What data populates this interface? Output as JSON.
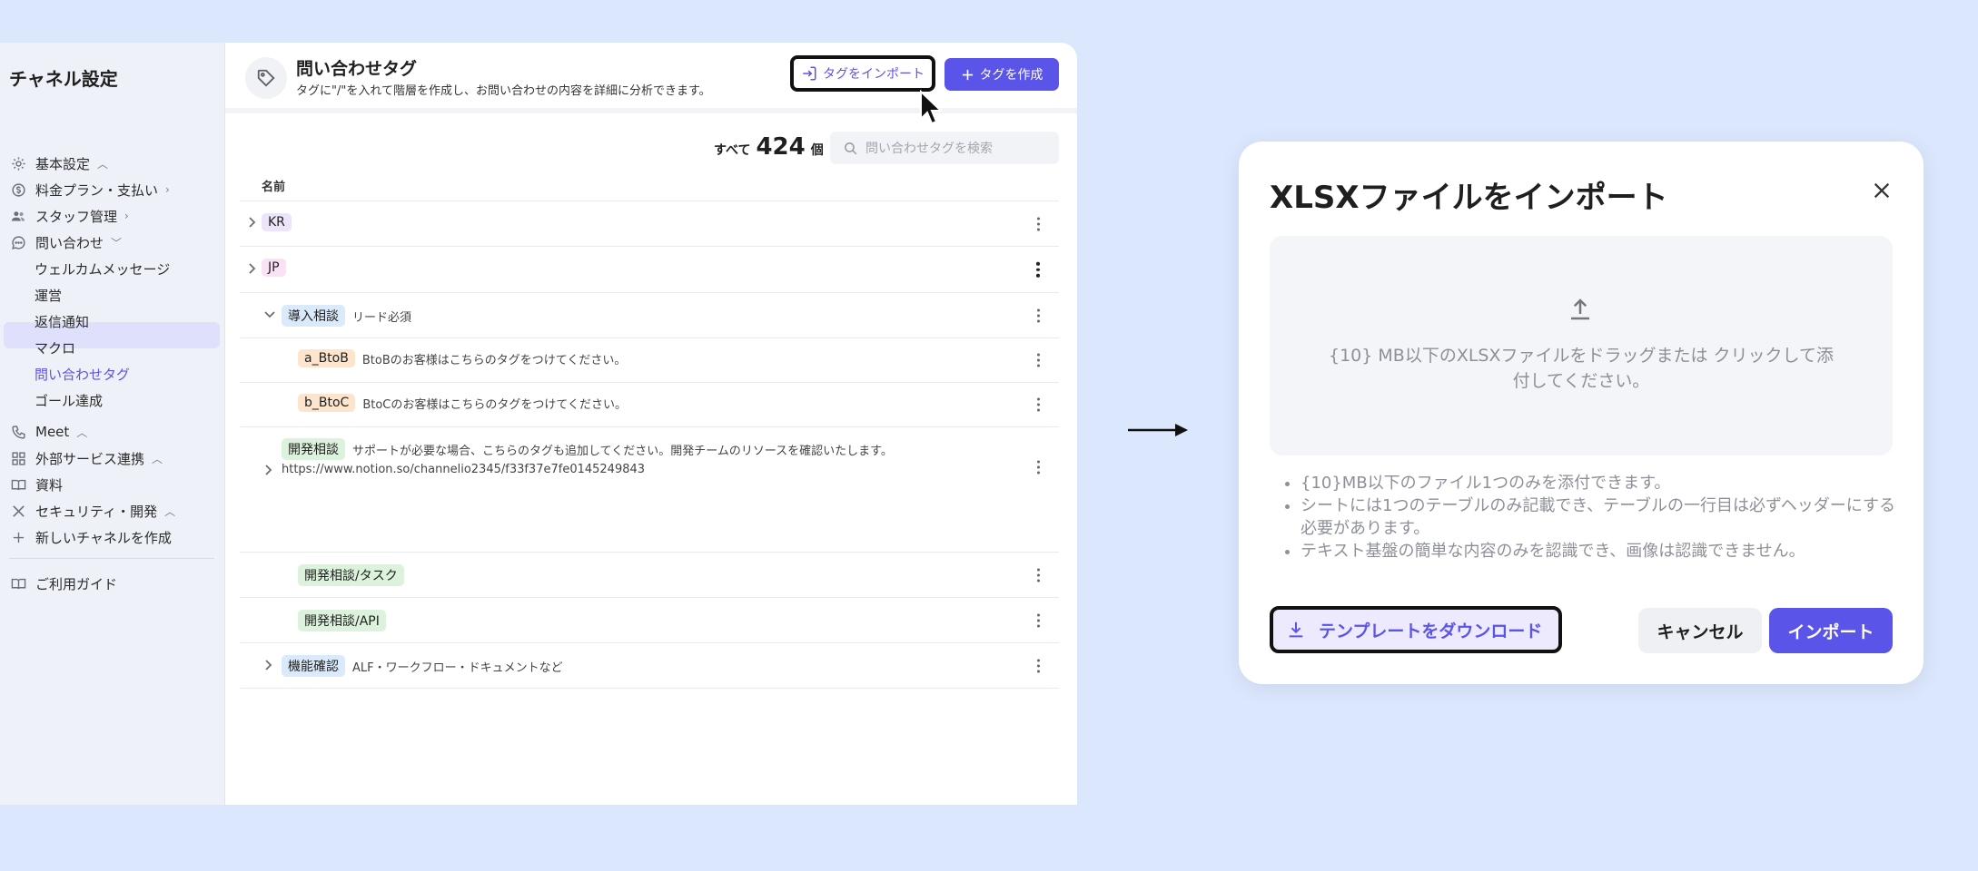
{
  "sidebar": {
    "title": "チャネル設定",
    "items": [
      {
        "label": "基本設定",
        "icon": "gear-icon"
      },
      {
        "label": "料金プラン・支払い",
        "icon": "dollar-icon"
      },
      {
        "label": "スタッフ管理",
        "icon": "people-icon"
      },
      {
        "label": "問い合わせ",
        "icon": "chat-icon"
      }
    ],
    "sub_items": [
      "ウェルカムメッセージ",
      "運営",
      "返信通知",
      "マクロ",
      "問い合わせタグ",
      "ゴール達成"
    ],
    "lower_items": [
      {
        "label": "Meet",
        "icon": "phone-icon"
      },
      {
        "label": "外部サービス連携",
        "icon": "grid-icon"
      },
      {
        "label": "資料",
        "icon": "book-icon"
      },
      {
        "label": "セキュリティ・開発",
        "icon": "tools-icon"
      },
      {
        "label": "新しいチャネルを作成",
        "icon": "plus-icon"
      }
    ],
    "guide": {
      "label": "ご利用ガイド",
      "icon": "book-icon"
    }
  },
  "header": {
    "title": "問い合わせタグ",
    "subtitle": "タグに\"/\"を入れて階層を作成し、お問い合わせの内容を詳細に分析できます。",
    "import_label": "タグをインポート",
    "create_label": "タグを作成"
  },
  "toolbar": {
    "count_label": "すべて",
    "count": "424",
    "count_unit": "個",
    "search_placeholder": "問い合わせタグを検索"
  },
  "table": {
    "column_name": "名前",
    "rows": [
      {
        "tag": "KR",
        "desc": ""
      },
      {
        "tag": "JP",
        "desc": ""
      },
      {
        "tag": "導入相談",
        "desc": "リード必須"
      },
      {
        "tag": "a_BtoB",
        "desc": "BtoBのお客様はこちらのタグをつけてください。"
      },
      {
        "tag": "b_BtoC",
        "desc": "BtoCのお客様はこちらのタグをつけてください。"
      },
      {
        "tag": "開発相談",
        "desc": "サポートが必要な場合、こちらのタグも追加してください。開発チームのリソースを確認いたします。",
        "desc2": "https://www.notion.so/channelio2345/f33f37e7fe0145249843"
      },
      {
        "tag": "開発相談/タスク",
        "desc": ""
      },
      {
        "tag": "開発相談/API",
        "desc": ""
      },
      {
        "tag": "機能確認",
        "desc": "ALF・ワークフロー・ドキュメントなど"
      }
    ]
  },
  "modal": {
    "title": "XLSXファイルをインポート",
    "dropzone_text": "{10} MB以下のXLSXファイルをドラッグまたは クリックして添付してください。",
    "notes": [
      "{10}MB以下のファイル1つのみを添付できます。",
      "シートには1つのテーブルのみ記載でき、テーブルの一行目は必ずヘッダーにする必要があります。",
      "テキスト基盤の簡単な内容のみを認識でき、画像は認識できません。"
    ],
    "download_label": "テンプレートをダウンロード",
    "cancel_label": "キャンセル",
    "import_label": "インポート"
  },
  "colors": {
    "accent": "#5b54e8",
    "background": "#dbe7fd",
    "highlight_border": "#111111"
  }
}
